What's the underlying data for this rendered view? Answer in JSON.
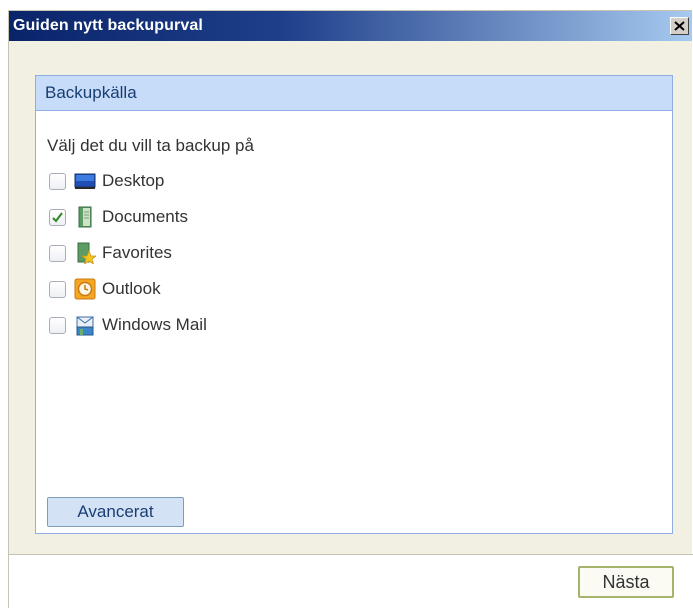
{
  "window": {
    "title": "Guiden nytt backupurval",
    "close_icon": "close-icon"
  },
  "panel": {
    "header": "Backupkälla",
    "prompt": "Välj det du vill ta backup på",
    "items": [
      {
        "label": "Desktop",
        "checked": false,
        "icon": "desktop-icon"
      },
      {
        "label": "Documents",
        "checked": true,
        "icon": "documents-icon"
      },
      {
        "label": "Favorites",
        "checked": false,
        "icon": "favorites-icon"
      },
      {
        "label": "Outlook",
        "checked": false,
        "icon": "outlook-icon"
      },
      {
        "label": "Windows Mail",
        "checked": false,
        "icon": "windows-mail-icon"
      }
    ],
    "advanced_label": "Avancerat"
  },
  "footer": {
    "next_label": "Nästa"
  },
  "colors": {
    "titlebar_start": "#0a246a",
    "titlebar_end": "#a6caf0",
    "panel_header_bg": "#c6dcf8",
    "check_color": "#2a8a1e",
    "next_border": "#a4b46a"
  }
}
